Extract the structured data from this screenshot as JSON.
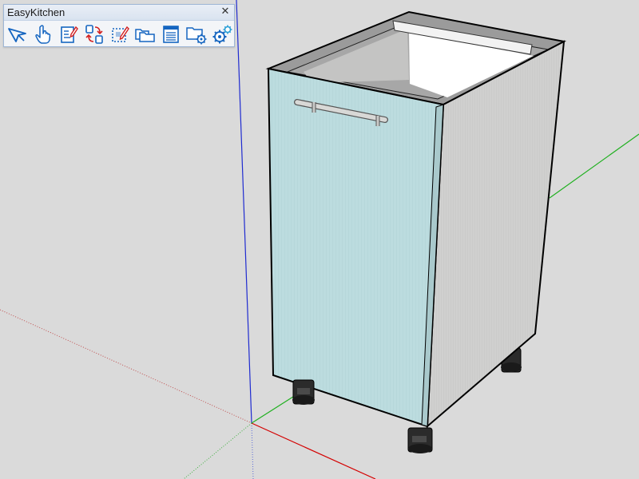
{
  "toolbar": {
    "title": "EasyKitchen",
    "close_glyph": "✕",
    "buttons": [
      {
        "name": "select-arrow-icon"
      },
      {
        "name": "hand-pointer-icon"
      },
      {
        "name": "edit-document-icon"
      },
      {
        "name": "swap-arrows-icon"
      },
      {
        "name": "edit-selection-icon"
      },
      {
        "name": "folders-icon"
      },
      {
        "name": "table-list-icon"
      },
      {
        "name": "folder-settings-icon"
      },
      {
        "name": "gears-icon"
      }
    ]
  },
  "colors": {
    "viewport_bg": "#dadada",
    "door": "#b9dadd",
    "cabinet_side": "#cfcfcf",
    "cabinet_top": "#9a9a9a",
    "icon_blue": "#1565c0",
    "axis_red": "#cc0000",
    "axis_green": "#00aa00",
    "axis_blue": "#0000cc"
  }
}
